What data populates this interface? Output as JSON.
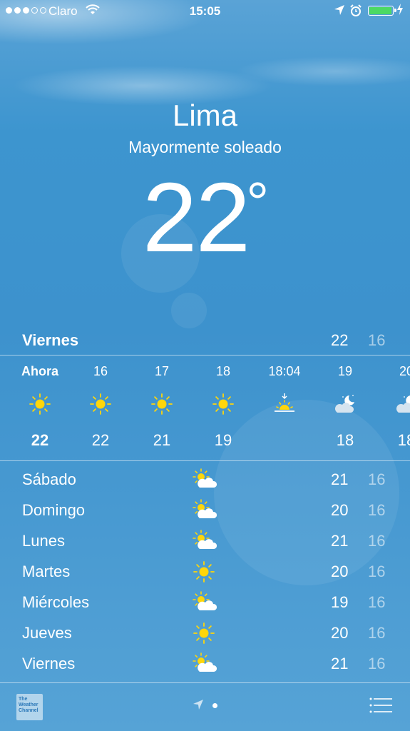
{
  "status": {
    "signal_bars": 5,
    "signal_filled": 3,
    "carrier": "Claro",
    "time": "15:05",
    "battery_level": 0.9,
    "icons": [
      "wifi-icon",
      "location-arrow-icon",
      "alarm-clock-icon",
      "battery-icon",
      "charging-bolt-icon"
    ]
  },
  "header": {
    "city": "Lima",
    "condition": "Mayormente soleado",
    "temperature": "22",
    "degree_symbol": "°"
  },
  "today": {
    "day": "Viernes",
    "high": "22",
    "low": "16"
  },
  "hourly": [
    {
      "time": "Ahora",
      "icon": "sun-icon",
      "temp": "22"
    },
    {
      "time": "16",
      "icon": "sun-icon",
      "temp": "22"
    },
    {
      "time": "17",
      "icon": "sun-icon",
      "temp": "21"
    },
    {
      "time": "18",
      "icon": "sun-icon",
      "temp": "19"
    },
    {
      "time": "18:04",
      "icon": "sunset-icon",
      "temp": ""
    },
    {
      "time": "19",
      "icon": "moon-cloud-icon",
      "temp": "18"
    },
    {
      "time": "20",
      "icon": "moon-cloud-icon",
      "temp": "18"
    }
  ],
  "daily": [
    {
      "day": "Sábado",
      "icon": "sun-cloud-icon",
      "high": "21",
      "low": "16"
    },
    {
      "day": "Domingo",
      "icon": "sun-cloud-icon",
      "high": "20",
      "low": "16"
    },
    {
      "day": "Lunes",
      "icon": "sun-cloud-icon",
      "high": "21",
      "low": "16"
    },
    {
      "day": "Martes",
      "icon": "sun-icon",
      "high": "20",
      "low": "16"
    },
    {
      "day": "Miércoles",
      "icon": "sun-cloud-icon",
      "high": "19",
      "low": "16"
    },
    {
      "day": "Jueves",
      "icon": "sun-icon",
      "high": "20",
      "low": "16"
    },
    {
      "day": "Viernes",
      "icon": "sun-cloud-icon",
      "high": "21",
      "low": "16"
    }
  ],
  "footer": {
    "logo_text": "The Weather Channel",
    "icons": [
      "weather-channel-logo",
      "location-arrow-icon",
      "page-dot",
      "list-icon"
    ]
  },
  "colors": {
    "sun": "#ffd60a",
    "low_temp_text": "rgba(255,255,255,0.55)",
    "battery": "#4cd964"
  }
}
